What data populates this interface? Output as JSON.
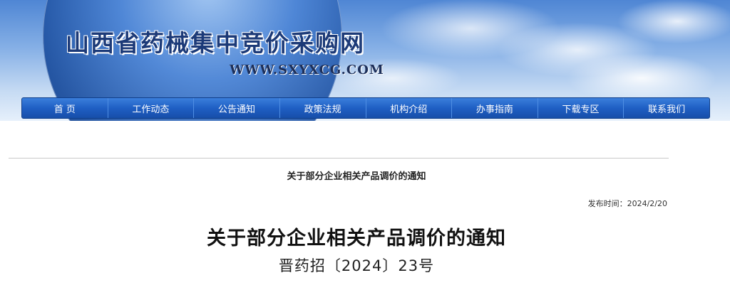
{
  "header": {
    "site_title": "山西省药械集中竞价采购网",
    "site_url": "WWW.SXYXCG.COM"
  },
  "nav": {
    "items": [
      {
        "label": "首 页"
      },
      {
        "label": "工作动态"
      },
      {
        "label": "公告通知"
      },
      {
        "label": "政策法规"
      },
      {
        "label": "机构介绍"
      },
      {
        "label": "办事指南"
      },
      {
        "label": "下载专区"
      },
      {
        "label": "联系我们"
      }
    ]
  },
  "article": {
    "header_title": "关于部分企业相关产品调价的通知",
    "publish_label": "发布时间：",
    "publish_date": "2024/2/20",
    "title": "关于部分企业相关产品调价的通知",
    "doc_number": "晋药招〔2024〕23号"
  },
  "colors": {
    "nav_bg": "#1f5fc4",
    "title_blue": "#1c3a78"
  }
}
